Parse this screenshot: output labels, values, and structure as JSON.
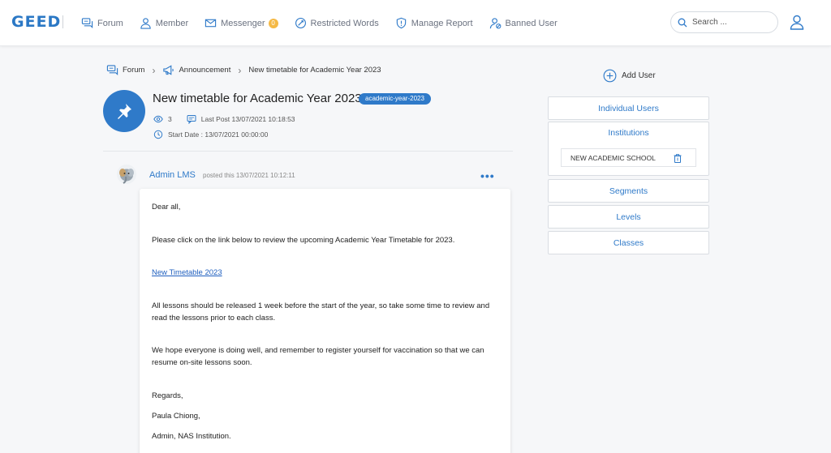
{
  "app": {
    "logo_text": "GEED"
  },
  "nav": {
    "items": [
      {
        "label": "Forum",
        "icon": "forum-icon"
      },
      {
        "label": "Member",
        "icon": "member-icon"
      },
      {
        "label": "Messenger",
        "icon": "mail-icon",
        "badge": "0"
      },
      {
        "label": "Restricted Words",
        "icon": "restricted-icon"
      },
      {
        "label": "Manage Report",
        "icon": "shield-icon"
      },
      {
        "label": "Banned User",
        "icon": "banned-user-icon"
      }
    ],
    "search_placeholder": "Search ..."
  },
  "breadcrumb": {
    "items": [
      "Forum",
      "Announcement",
      "New timetable for Academic Year 2023"
    ]
  },
  "thread": {
    "title": "New timetable for Academic Year 2023",
    "tag": "academic-year-2023",
    "views": "3",
    "last_post": "Last Post 13/07/2021 10:18:53",
    "start_date": "Start Date : 13/07/2021 00:00:00"
  },
  "post": {
    "author": "Admin LMS",
    "posted": "posted this 13/07/2021 10:12:11",
    "more": "•••",
    "greeting": "Dear all,",
    "para1": "Please click on the link below to review the upcoming Academic Year Timetable for 2023.",
    "link_text": "New Timetable 2023",
    "para2": "All lessons should be released 1 week before the start of the year, so take some time to review and read the lessons prior to each class.",
    "para3": "We hope everyone is doing well, and remember to register yourself for vaccination so that we can resume on-site lessons soon.",
    "signoff": "Regards,",
    "sig_name": "Paula Chiong,",
    "sig_title": "Admin, NAS Institution."
  },
  "panel": {
    "add_user": "Add User",
    "individual_users": "Individual Users",
    "institutions": "Institutions",
    "institution_item": "NEW ACADEMIC SCHOOL",
    "segments": "Segments",
    "levels": "Levels",
    "classes": "Classes"
  },
  "colors": {
    "accent": "#2f7ac9",
    "badge": "#f5b945",
    "link": "#1f5fbf"
  }
}
